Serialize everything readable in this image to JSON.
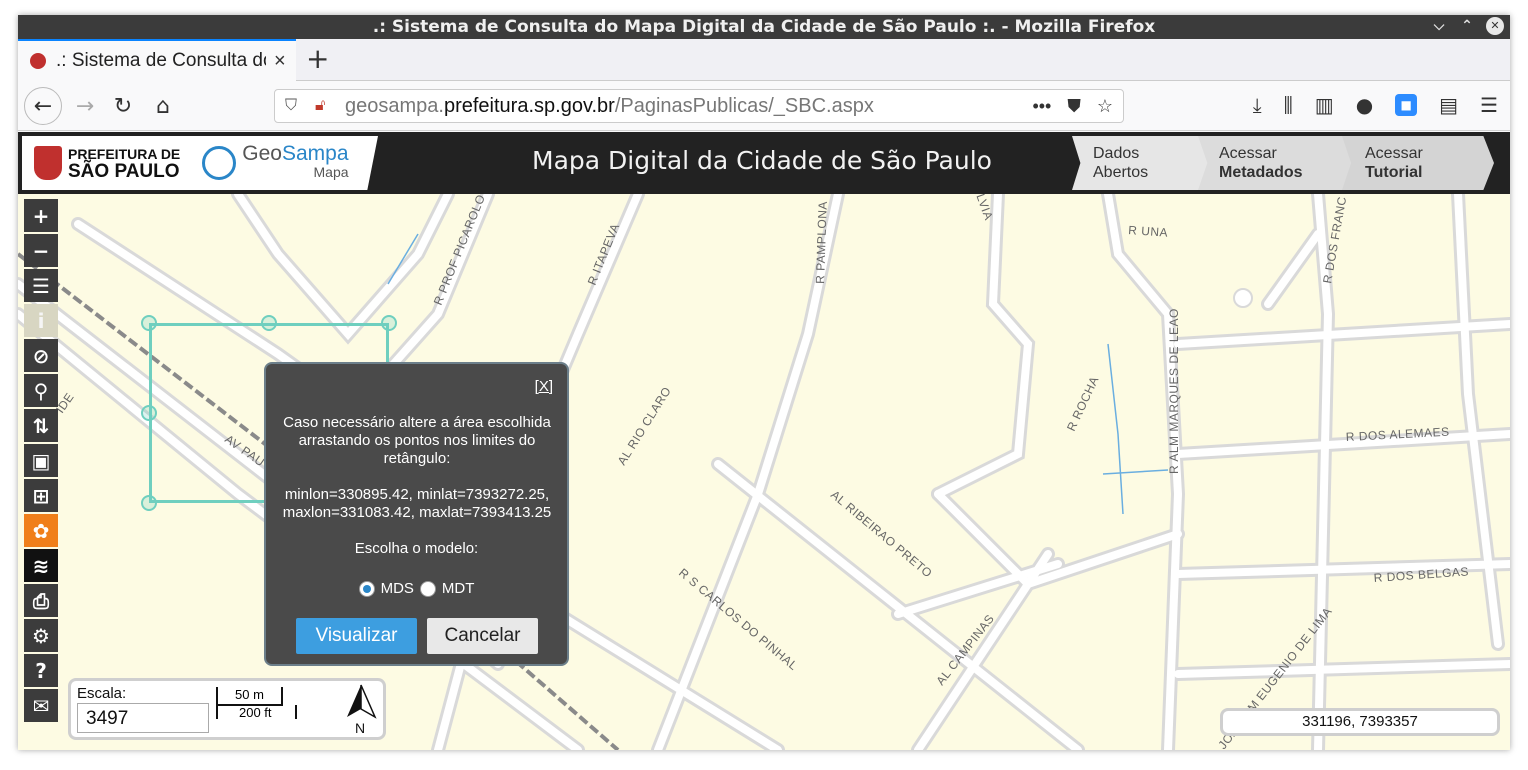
{
  "window": {
    "title": ".: Sistema de Consulta do Mapa Digital da Cidade de São Paulo :. - Mozilla Firefox"
  },
  "tab": {
    "label": ".: Sistema de Consulta do Mapa Digital da Cidade de São Paulo :.",
    "close": "×",
    "new": "+"
  },
  "url": {
    "prefix": "geosampa.",
    "domain": "prefeitura.sp.gov.br",
    "path": "/PaginasPublicas/_SBC.aspx"
  },
  "header": {
    "pref_line1": "PREFEITURA DE",
    "pref_line2": "SÃO PAULO",
    "geo_a": "Geo",
    "geo_b": "Sampa",
    "geo_sub": "Mapa",
    "title": "Mapa Digital da Cidade de São Paulo",
    "btn1_l1": "Dados",
    "btn1_l2": "Abertos",
    "btn2_l1": "Acessar",
    "btn2_l2": "Metadados",
    "btn3_l1": "Acessar",
    "btn3_l2": "Tutorial"
  },
  "dialog": {
    "close": "[X]",
    "message": "Caso necessário altere a área escolhida arrastando os pontos nos limites do retângulo:",
    "coords_line1": "minlon=330895.42, minlat=7393272.25,",
    "coords_line2": "maxlon=331083.42, maxlat=7393413.25",
    "choose": "Escolha o modelo:",
    "opt1": "MDS",
    "opt2": "MDT",
    "selected": "MDS",
    "btn_view": "Visualizar",
    "btn_cancel": "Cancelar"
  },
  "scale": {
    "label": "Escala:",
    "value": "3497",
    "m": "50 m",
    "ft": "200 ft",
    "north": "N"
  },
  "coordinates": "331196, 7393357",
  "streets": {
    "s1": "R PROF PICAROLO",
    "s2": "R ITAPEVA",
    "s3": "R PAMPLONA",
    "s4": "R UNA",
    "s5": "R DOS FRANC",
    "s6": "R ALM MARQUES DE LEAO",
    "s7": "R ROCHA",
    "s8": "R DOS ALEMAES",
    "s9": "AL RIO CLARO",
    "s10": "AL RIBEIRAO PRETO",
    "s11": "R S CARLOS DO PINHAL",
    "s12": "AL CAMPINAS",
    "s13": "R DOS BELGAS",
    "s14": "JOAQUIM EUGENIO DE LIMA",
    "s15": "AV PAU",
    "s16": "SILVIA",
    "s17": "IDE"
  }
}
